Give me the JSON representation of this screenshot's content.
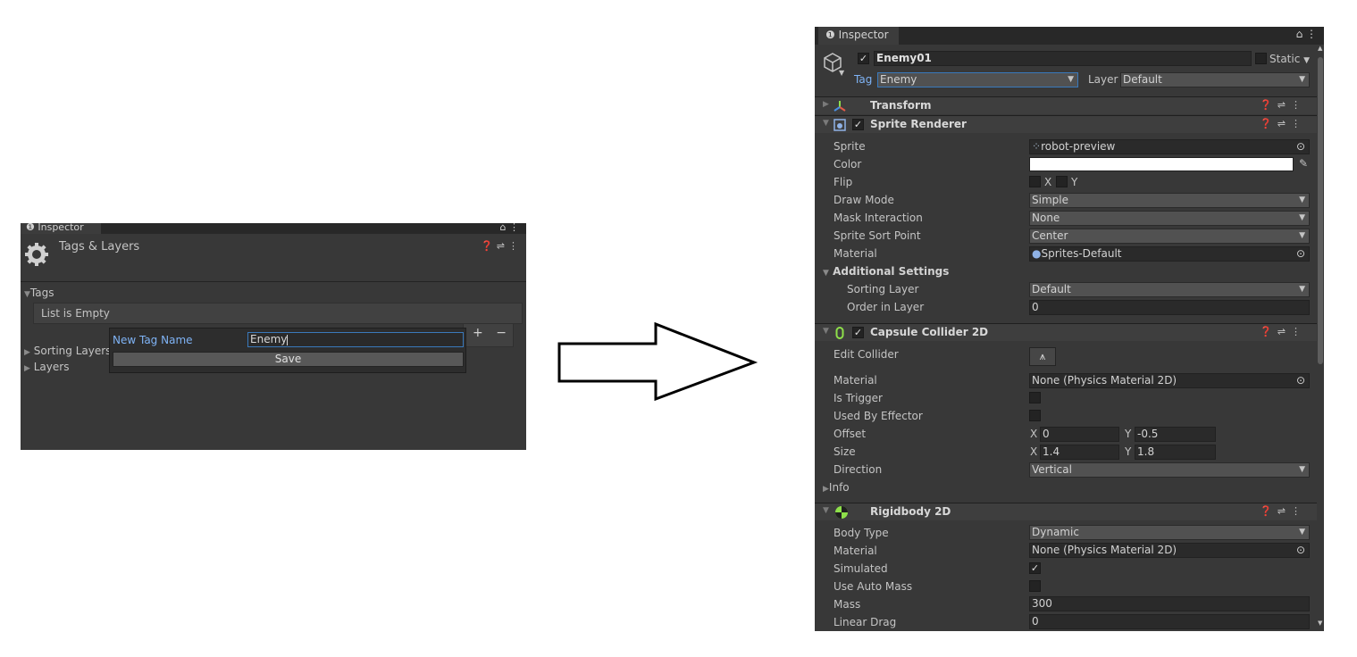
{
  "left_panel": {
    "tab": "Inspector",
    "title": "Tags & Layers",
    "tags_label": "Tags",
    "list_empty": "List is Empty",
    "plus": "+",
    "minus": "−",
    "sorting_layers": "Sorting Layers",
    "layers": "Layers",
    "popup": {
      "label": "New Tag Name",
      "value": "Enemy",
      "save": "Save"
    }
  },
  "right_panel": {
    "tab": "Inspector",
    "object": {
      "name": "Enemy01",
      "active": true,
      "static_label": "Static",
      "tag_label": "Tag",
      "tag_value": "Enemy",
      "layer_label": "Layer",
      "layer_value": "Default"
    },
    "transform": {
      "name": "Transform"
    },
    "sprite_renderer": {
      "name": "Sprite Renderer",
      "enabled": true,
      "rows": {
        "sprite_label": "Sprite",
        "sprite_value": "robot-preview",
        "color_label": "Color",
        "color_value": "#ffffff",
        "flip_label": "Flip",
        "flip_x": "X",
        "flip_y": "Y",
        "draw_mode_label": "Draw Mode",
        "draw_mode_value": "Simple",
        "mask_label": "Mask Interaction",
        "mask_value": "None",
        "sort_point_label": "Sprite Sort Point",
        "sort_point_value": "Center",
        "material_label": "Material",
        "material_value": "Sprites-Default",
        "additional_label": "Additional Settings",
        "sorting_layer_label": "Sorting Layer",
        "sorting_layer_value": "Default",
        "order_label": "Order in Layer",
        "order_value": "0"
      }
    },
    "capsule_collider": {
      "name": "Capsule Collider 2D",
      "enabled": true,
      "rows": {
        "edit_label": "Edit Collider",
        "material_label": "Material",
        "material_value": "None (Physics Material 2D)",
        "trigger_label": "Is Trigger",
        "effector_label": "Used By Effector",
        "offset_label": "Offset",
        "offset_x_lbl": "X",
        "offset_x": "0",
        "offset_y_lbl": "Y",
        "offset_y": "-0.5",
        "size_label": "Size",
        "size_x_lbl": "X",
        "size_x": "1.4",
        "size_y_lbl": "Y",
        "size_y": "1.8",
        "direction_label": "Direction",
        "direction_value": "Vertical",
        "info_label": "Info"
      }
    },
    "rigidbody": {
      "name": "Rigidbody 2D",
      "rows": {
        "body_type_label": "Body Type",
        "body_type_value": "Dynamic",
        "material_label": "Material",
        "material_value": "None (Physics Material 2D)",
        "simulated_label": "Simulated",
        "auto_mass_label": "Use Auto Mass",
        "mass_label": "Mass",
        "mass_value": "300",
        "linear_drag_label": "Linear Drag",
        "linear_drag_value": "0"
      }
    }
  },
  "colors": {
    "panel_bg": "#383838",
    "accent_blue": "#7fb3f5",
    "field_focus": "#3a79bb"
  }
}
